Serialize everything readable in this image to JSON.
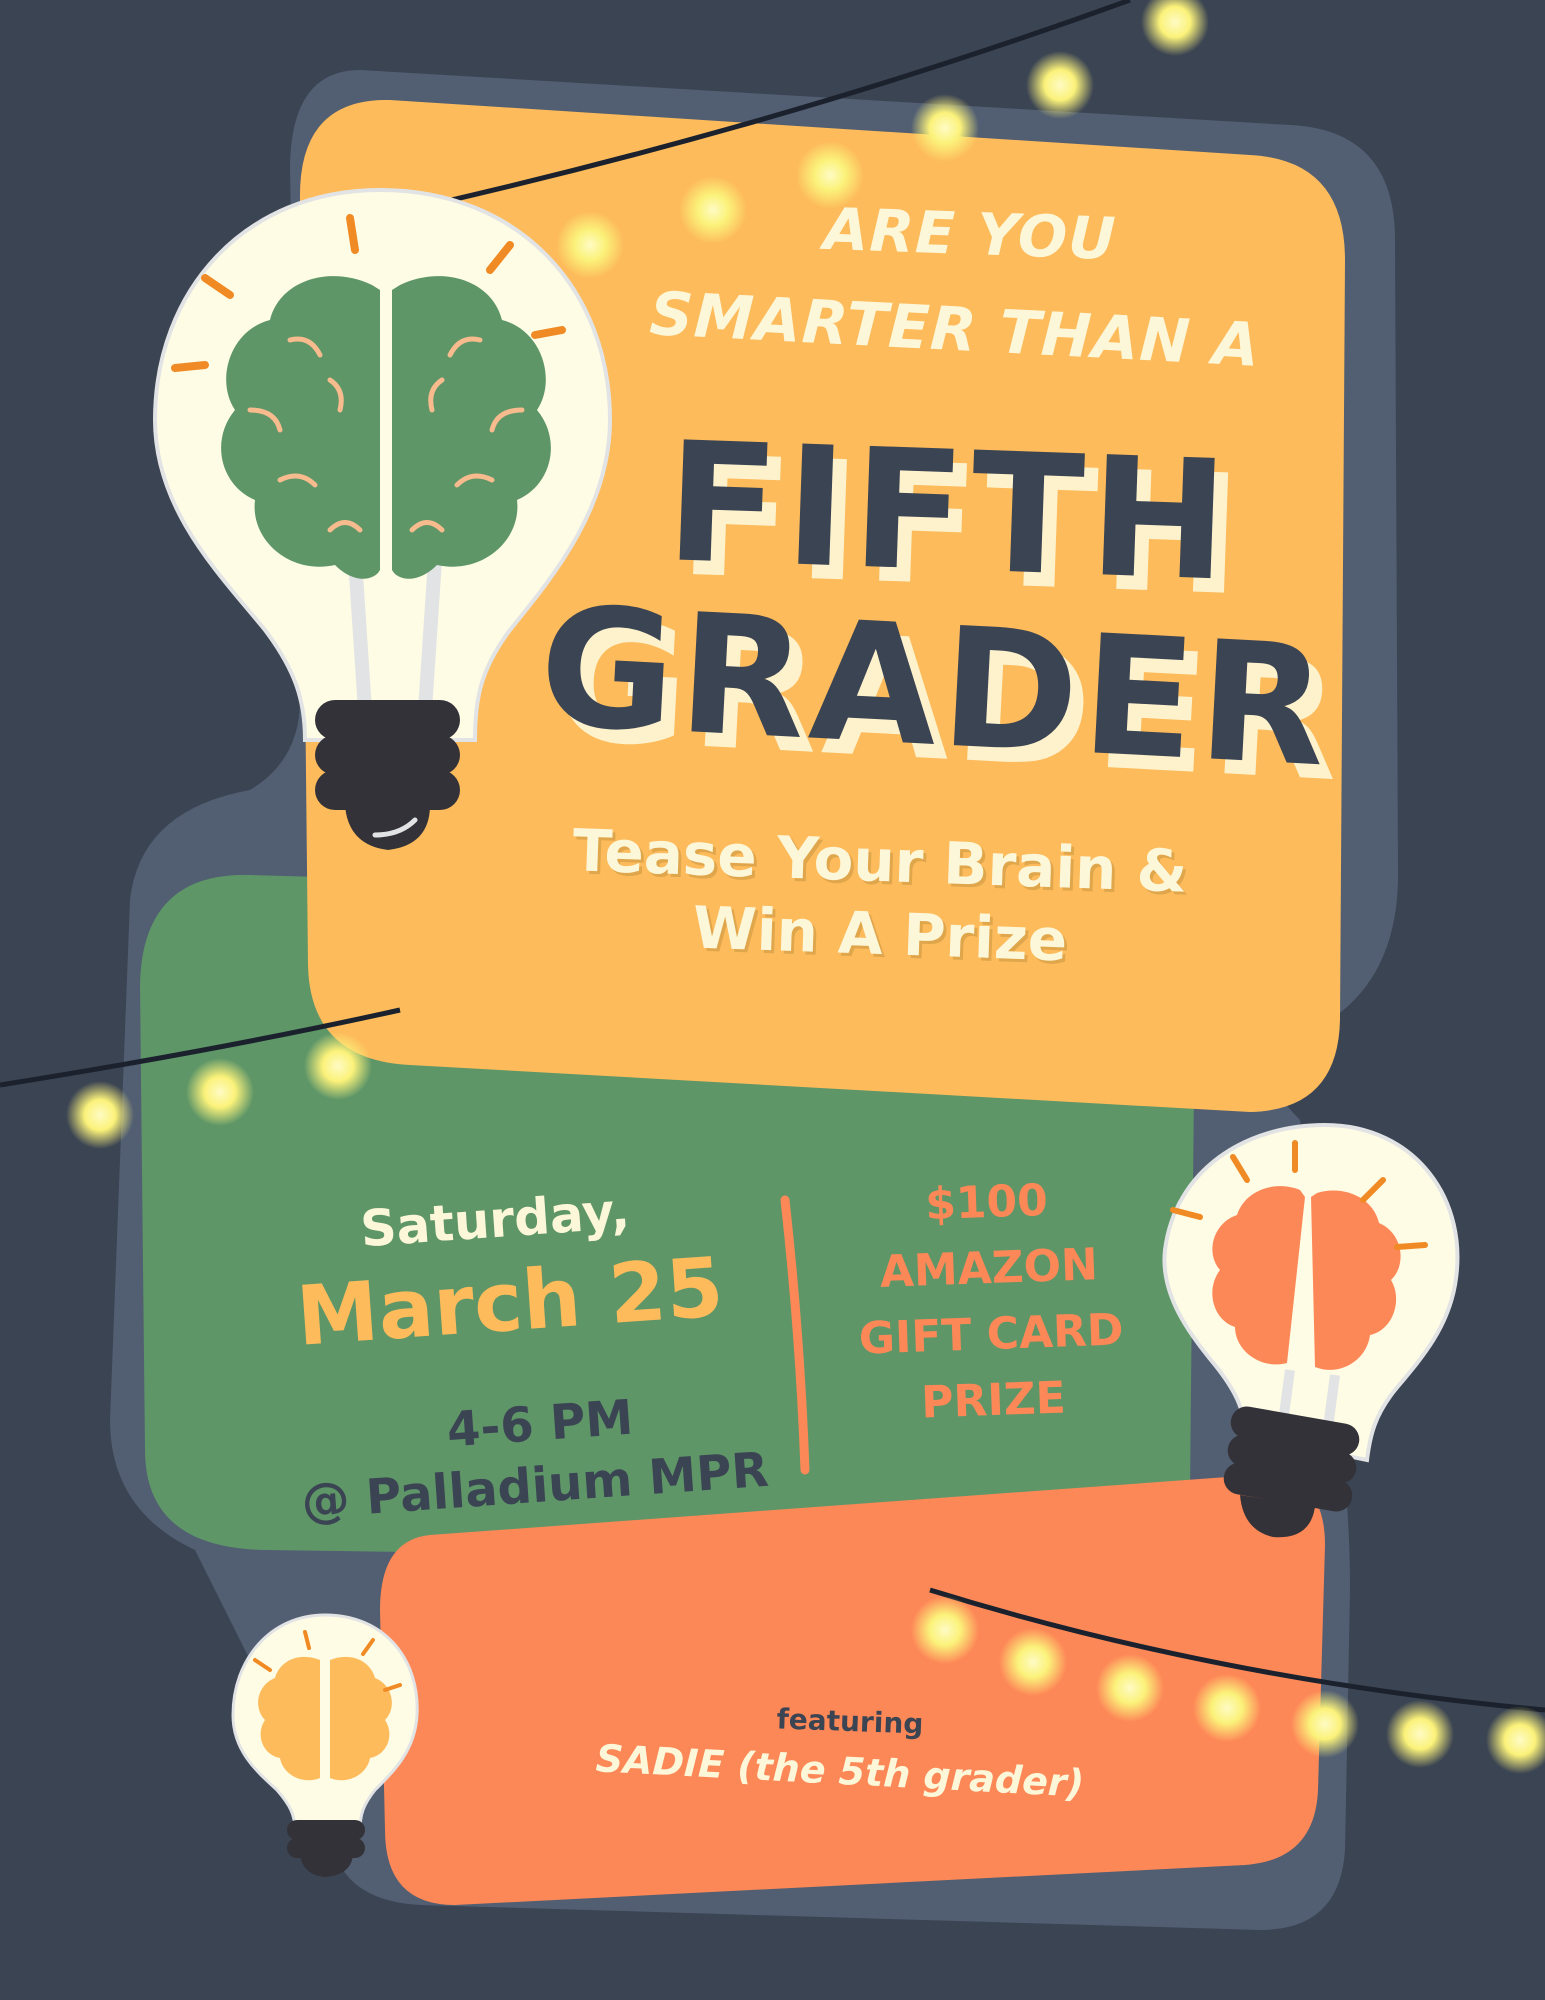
{
  "colors": {
    "background": "#3b4453",
    "outline": "#525f72",
    "orange_panel": "#fdbb5b",
    "green_panel": "#5e9668",
    "coral_panel": "#fd8857",
    "cream": "#fdf7d9",
    "navy_text": "#3b4453",
    "bulb_glass": "#fefce5",
    "socket": "#333238",
    "light_glow": "#fbf27a"
  },
  "headline": {
    "line1": "ARE YOU",
    "line2": "SMARTER THAN A",
    "line3": "FIFTH",
    "line4": "GRADER"
  },
  "tagline": {
    "line1": "Tease Your Brain &",
    "line2": "Win A Prize"
  },
  "event": {
    "day": "Saturday,",
    "date": "March 25",
    "time": "4-6 PM",
    "venue": "@ Palladium MPR"
  },
  "prize": {
    "line1": "$100",
    "line2": "AMAZON",
    "line3": "GIFT CARD",
    "line4": "PRIZE"
  },
  "featuring": {
    "label": "featuring",
    "name": "SADIE (the 5th grader)"
  },
  "icons": {
    "large_bulb": "brain-lightbulb-icon",
    "medium_bulb": "brain-lightbulb-icon",
    "small_bulb": "brain-lightbulb-icon",
    "string_lights": "string-lights-icon"
  }
}
